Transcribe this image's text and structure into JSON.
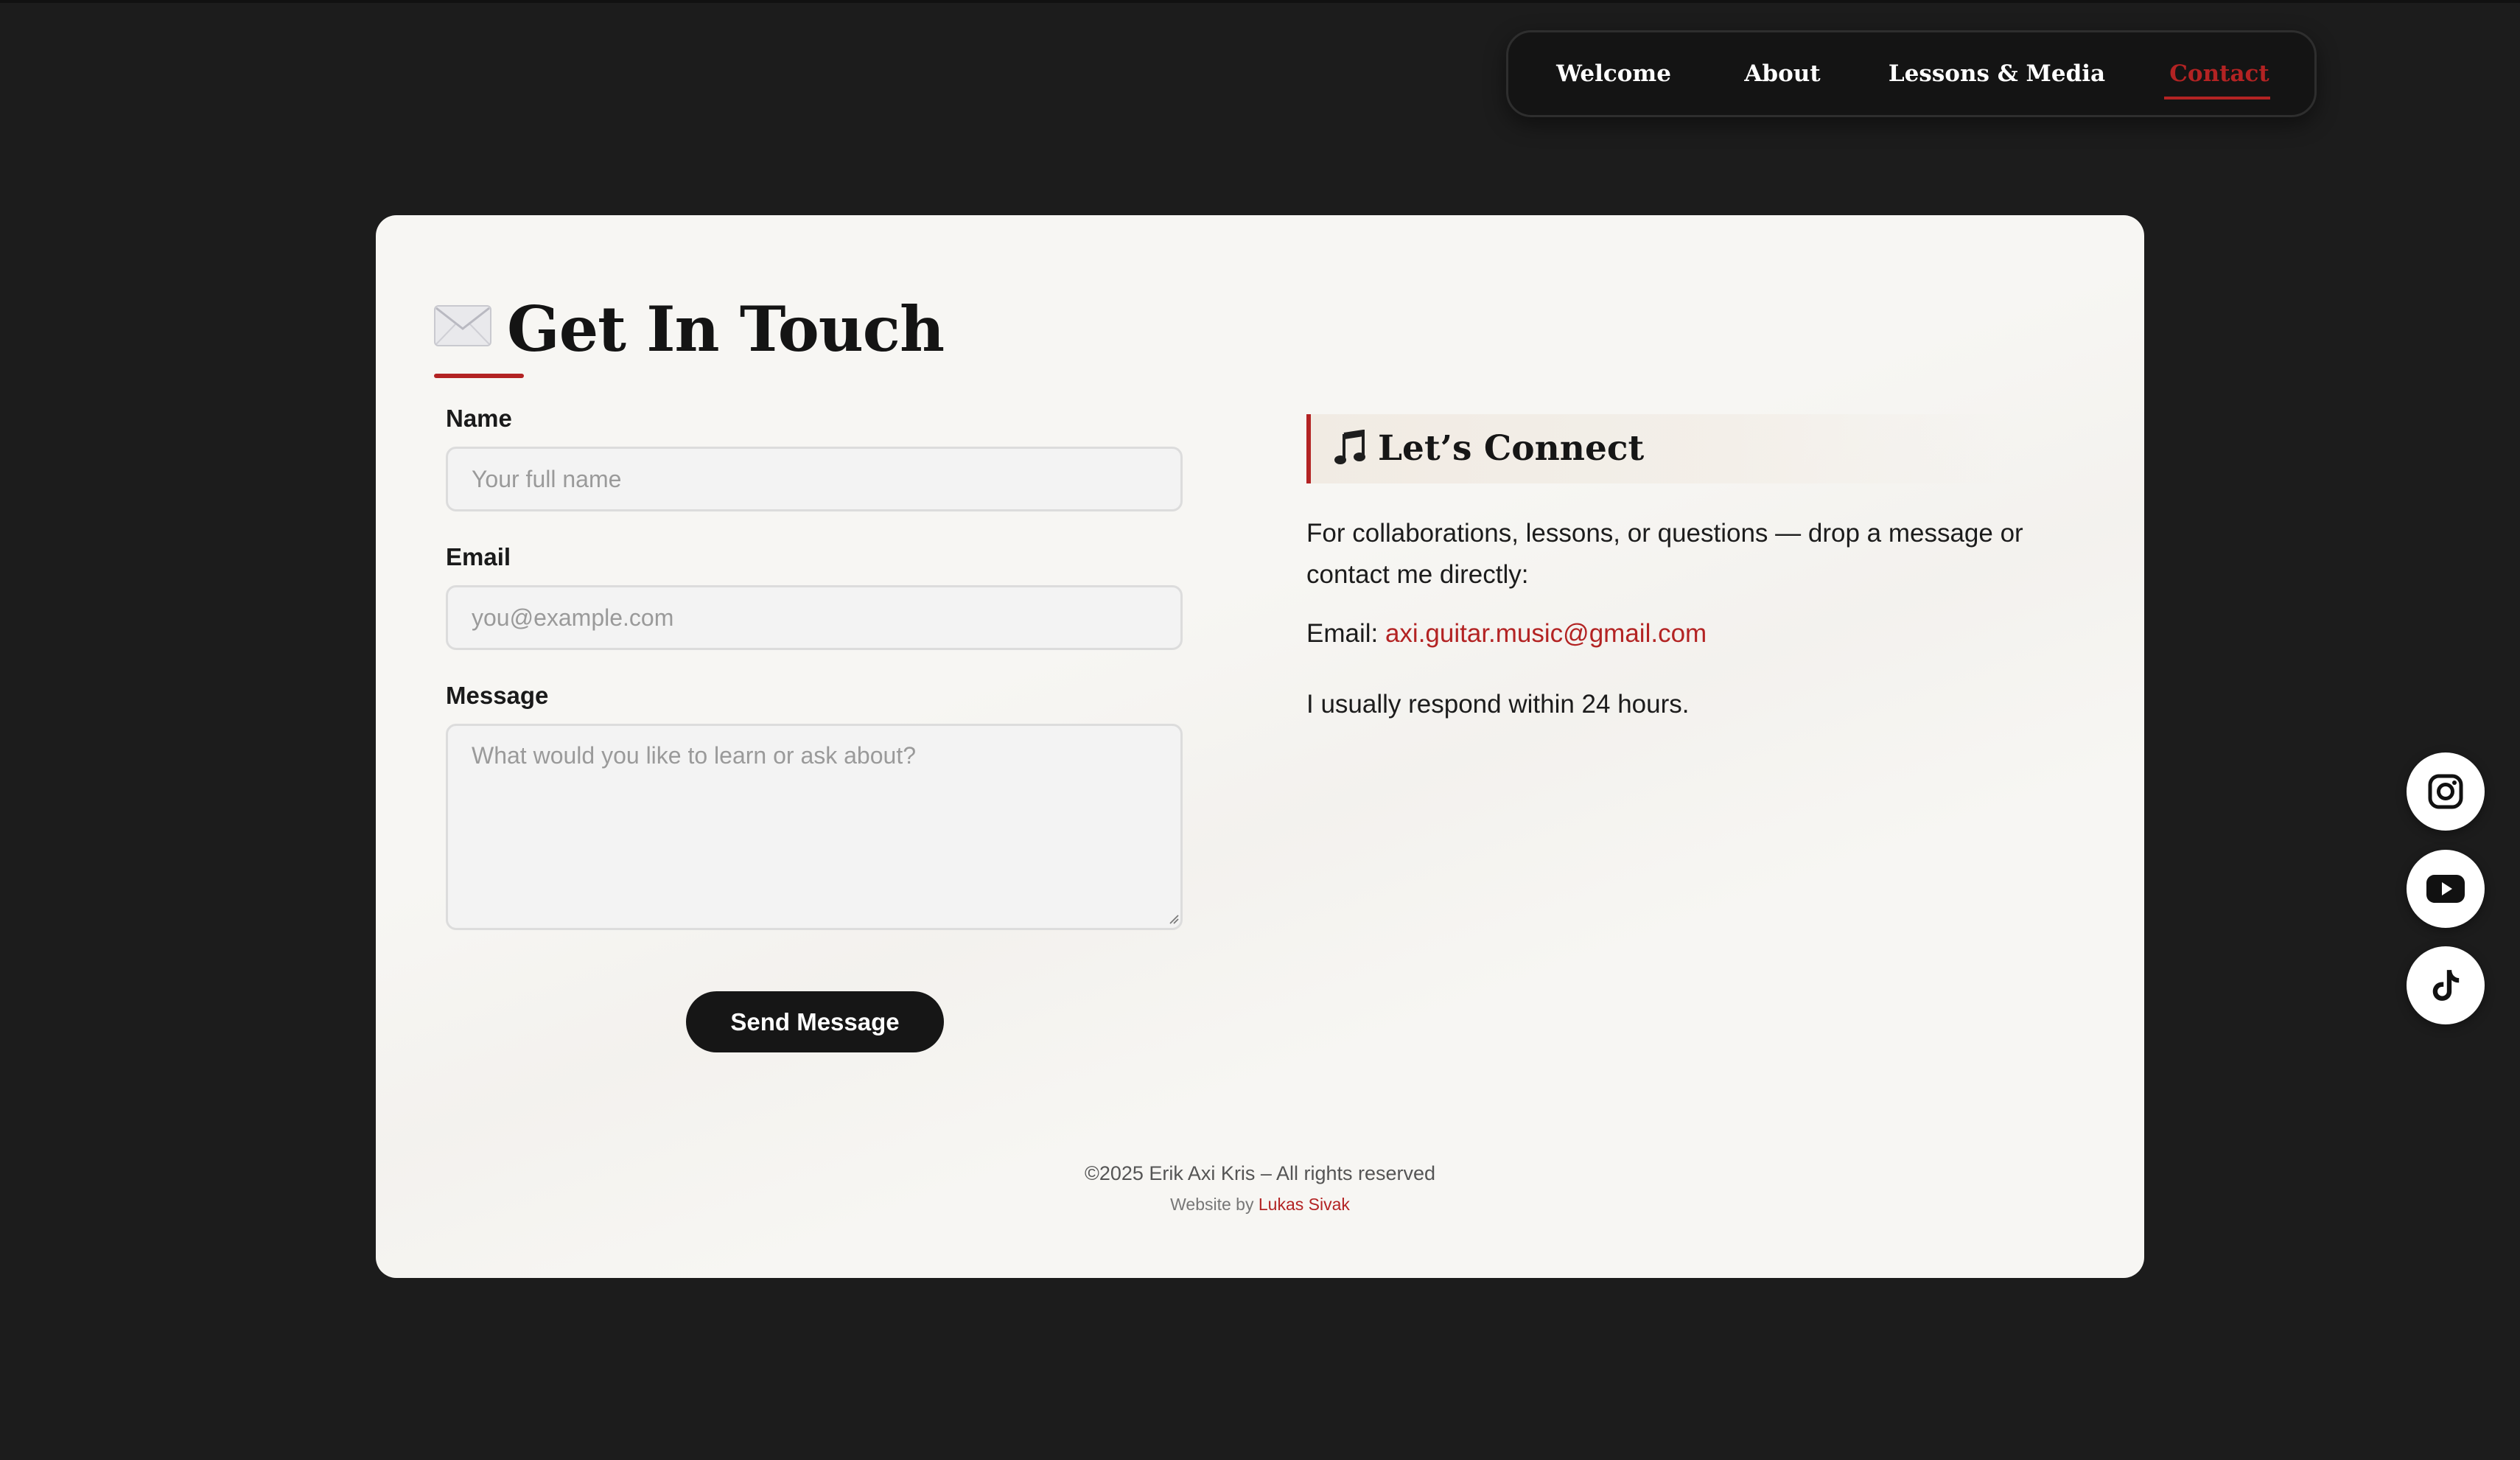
{
  "nav": {
    "items": [
      {
        "label": "Welcome",
        "active": false
      },
      {
        "label": "About",
        "active": false
      },
      {
        "label": "Lessons & Media",
        "active": false
      },
      {
        "label": "Contact",
        "active": true
      }
    ],
    "active_color": "#b32323"
  },
  "contact": {
    "title": "Get In Touch",
    "title_icon": "envelope-icon",
    "form": {
      "name": {
        "label": "Name",
        "placeholder": "Your full name",
        "value": ""
      },
      "email": {
        "label": "Email",
        "placeholder": "you@example.com",
        "value": ""
      },
      "message": {
        "label": "Message",
        "placeholder": "What would you like to learn or ask about?",
        "value": ""
      },
      "submit_label": "Send Message"
    },
    "connect": {
      "icon": "music-note-icon",
      "title": "Let’s Connect",
      "intro": "For collaborations, lessons, or questions — drop a message or contact me directly:",
      "email_prefix": "Email: ",
      "email": "axi.guitar.music@gmail.com",
      "response_note": "I usually respond within 24 hours."
    }
  },
  "footer": {
    "copyright": "©2025 Erik Axi Kris – All rights reserved",
    "credit_prefix": "Website by ",
    "credit_name": "Lukas Sivak"
  },
  "social": [
    {
      "name": "instagram",
      "icon": "instagram-icon"
    },
    {
      "name": "youtube",
      "icon": "youtube-icon"
    },
    {
      "name": "tiktok",
      "icon": "tiktok-icon"
    }
  ],
  "colors": {
    "background": "#1c1c1c",
    "card": "#f7f6f3",
    "accent": "#b32323",
    "button": "#161616"
  }
}
